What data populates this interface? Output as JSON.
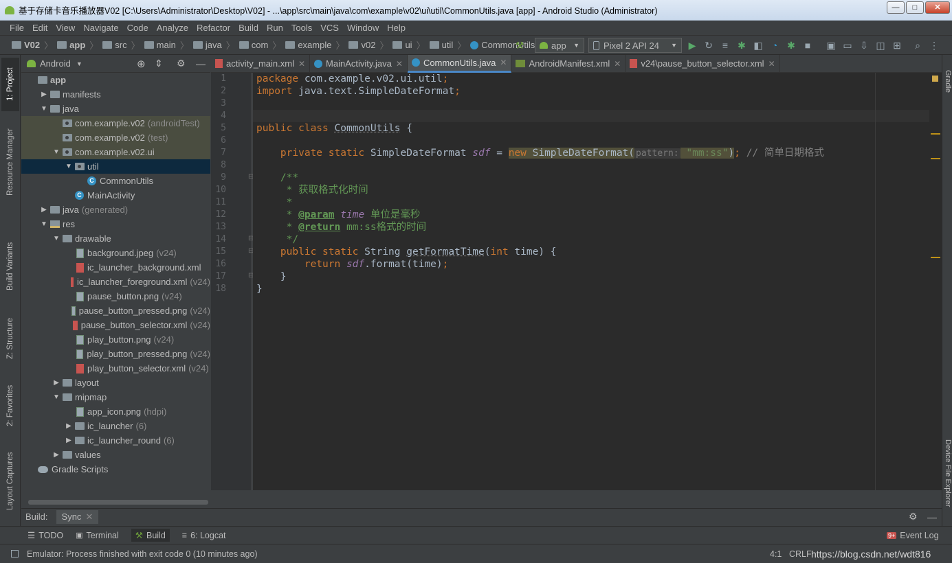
{
  "window": {
    "title": "基于存储卡音乐播放器V02 [C:\\Users\\Administrator\\Desktop\\V02] - ...\\app\\src\\main\\java\\com\\example\\v02\\ui\\util\\CommonUtils.java [app] - Android Studio (Administrator)",
    "controls": [
      "—",
      "□",
      "✕"
    ]
  },
  "menu": [
    "File",
    "Edit",
    "View",
    "Navigate",
    "Code",
    "Analyze",
    "Refactor",
    "Build",
    "Run",
    "Tools",
    "VCS",
    "Window",
    "Help"
  ],
  "breadcrumbs": [
    "V02",
    "app",
    "src",
    "main",
    "java",
    "com",
    "example",
    "v02",
    "ui",
    "util",
    "CommonUtils"
  ],
  "toolbar": {
    "run_config": "app",
    "device": "Pixel 2 API 24"
  },
  "left_tabs": [
    "1: Project",
    "Resource Manager",
    "Build Variants",
    "Z: Structure",
    "2: Favorites",
    "Layout Captures"
  ],
  "right_tabs": [
    "Gradle",
    "Device File Explorer"
  ],
  "project": {
    "view_mode": "Android",
    "tree": [
      {
        "label": "app",
        "extra": "",
        "indent": 0,
        "arrow": "",
        "icon": "folder",
        "bold": true
      },
      {
        "label": "manifests",
        "extra": "",
        "indent": 1,
        "arrow": "▶",
        "icon": "folder"
      },
      {
        "label": "java",
        "extra": "",
        "indent": 1,
        "arrow": "▼",
        "icon": "folder"
      },
      {
        "label": "com.example.v02",
        "extra": "(androidTest)",
        "indent": 2,
        "arrow": "",
        "icon": "pkg",
        "state": "hl"
      },
      {
        "label": "com.example.v02",
        "extra": "(test)",
        "indent": 2,
        "arrow": "",
        "icon": "pkg",
        "state": "hl"
      },
      {
        "label": "com.example.v02.ui",
        "extra": "",
        "indent": 2,
        "arrow": "▼",
        "icon": "pkg",
        "state": "hl"
      },
      {
        "label": "util",
        "extra": "",
        "indent": 3,
        "arrow": "▼",
        "icon": "pkg",
        "state": "sel"
      },
      {
        "label": "CommonUtils",
        "extra": "",
        "indent": 4,
        "arrow": "",
        "icon": "class"
      },
      {
        "label": "MainActivity",
        "extra": "",
        "indent": 3,
        "arrow": "",
        "icon": "class"
      },
      {
        "label": "java",
        "extra": "(generated)",
        "indent": 1,
        "arrow": "▶",
        "icon": "folder"
      },
      {
        "label": "res",
        "extra": "",
        "indent": 1,
        "arrow": "▼",
        "icon": "res"
      },
      {
        "label": "drawable",
        "extra": "",
        "indent": 2,
        "arrow": "▼",
        "icon": "folder"
      },
      {
        "label": "background.jpeg",
        "extra": "(v24)",
        "indent": 3,
        "arrow": "",
        "icon": "png"
      },
      {
        "label": "ic_launcher_background.xml",
        "extra": "",
        "indent": 3,
        "arrow": "",
        "icon": "xml"
      },
      {
        "label": "ic_launcher_foreground.xml",
        "extra": "(v24)",
        "indent": 3,
        "arrow": "",
        "icon": "xml"
      },
      {
        "label": "pause_button.png",
        "extra": "(v24)",
        "indent": 3,
        "arrow": "",
        "icon": "png"
      },
      {
        "label": "pause_button_pressed.png",
        "extra": "(v24)",
        "indent": 3,
        "arrow": "",
        "icon": "png"
      },
      {
        "label": "pause_button_selector.xml",
        "extra": "(v24)",
        "indent": 3,
        "arrow": "",
        "icon": "xml"
      },
      {
        "label": "play_button.png",
        "extra": "(v24)",
        "indent": 3,
        "arrow": "",
        "icon": "png"
      },
      {
        "label": "play_button_pressed.png",
        "extra": "(v24)",
        "indent": 3,
        "arrow": "",
        "icon": "png"
      },
      {
        "label": "play_button_selector.xml",
        "extra": "(v24)",
        "indent": 3,
        "arrow": "",
        "icon": "xml"
      },
      {
        "label": "layout",
        "extra": "",
        "indent": 2,
        "arrow": "▶",
        "icon": "folder"
      },
      {
        "label": "mipmap",
        "extra": "",
        "indent": 2,
        "arrow": "▼",
        "icon": "folder"
      },
      {
        "label": "app_icon.png",
        "extra": "(hdpi)",
        "indent": 3,
        "arrow": "",
        "icon": "png"
      },
      {
        "label": "ic_launcher",
        "extra": "(6)",
        "indent": 3,
        "arrow": "▶",
        "icon": "folder"
      },
      {
        "label": "ic_launcher_round",
        "extra": "(6)",
        "indent": 3,
        "arrow": "▶",
        "icon": "folder"
      },
      {
        "label": "values",
        "extra": "",
        "indent": 2,
        "arrow": "▶",
        "icon": "folder"
      },
      {
        "label": "Gradle Scripts",
        "extra": "",
        "indent": 0,
        "arrow": "",
        "icon": "gradle"
      }
    ]
  },
  "editor_tabs": [
    {
      "label": "activity_main.xml",
      "icon": "xml",
      "active": false
    },
    {
      "label": "MainActivity.java",
      "icon": "class",
      "active": false
    },
    {
      "label": "CommonUtils.java",
      "icon": "class",
      "active": true
    },
    {
      "label": "AndroidManifest.xml",
      "icon": "manifest",
      "active": false
    },
    {
      "label": "v24\\pause_button_selector.xml",
      "icon": "xml",
      "active": false
    }
  ],
  "code": {
    "line_numbers": [
      "1",
      "2",
      "3",
      "4",
      "5",
      "6",
      "7",
      "8",
      "9",
      "10",
      "11",
      "12",
      "13",
      "14",
      "15",
      "16",
      "17",
      "18"
    ],
    "lines": [
      [
        [
          "kw",
          "package "
        ],
        [
          "",
          "com.example.v02.ui.util"
        ],
        [
          "kw",
          ";"
        ]
      ],
      [
        [
          "kw",
          "import "
        ],
        [
          "",
          "java.text.SimpleDateFormat"
        ],
        [
          "kw",
          ";"
        ]
      ],
      [],
      [],
      [
        [
          "kw",
          "public class "
        ],
        [
          "unused",
          "CommonUtils"
        ],
        [
          "",
          " {"
        ]
      ],
      [],
      [
        [
          "",
          "    "
        ],
        [
          "kw",
          "private static "
        ],
        [
          "",
          "SimpleDateFormat "
        ],
        [
          "fld",
          "sdf"
        ],
        [
          "",
          " = "
        ],
        [
          "kw hlnew",
          "new "
        ],
        [
          "hlnew",
          "SimpleDateFormat("
        ],
        [
          "hint",
          "pattern:"
        ],
        [
          "str hlnew",
          " \"mm:ss\""
        ],
        [
          "hlnew",
          ")"
        ],
        [
          "kw",
          "; "
        ],
        [
          "cm",
          "// 简单日期格式"
        ]
      ],
      [],
      [
        [
          "",
          "    "
        ],
        [
          "doc",
          "/**"
        ]
      ],
      [
        [
          "",
          "    "
        ],
        [
          "doc",
          " * 获取格式化时间"
        ]
      ],
      [
        [
          "",
          "    "
        ],
        [
          "doc",
          " *"
        ]
      ],
      [
        [
          "",
          "    "
        ],
        [
          "doc",
          " * "
        ],
        [
          "tag",
          "@param"
        ],
        [
          "doc",
          " "
        ],
        [
          "fld",
          "time"
        ],
        [
          "doc",
          " 单位是毫秒"
        ]
      ],
      [
        [
          "",
          "    "
        ],
        [
          "doc",
          " * "
        ],
        [
          "tag",
          "@return"
        ],
        [
          "doc",
          " "
        ],
        [
          "doc",
          "mm:ss格式的时间"
        ]
      ],
      [
        [
          "",
          "    "
        ],
        [
          "doc",
          " */"
        ]
      ],
      [
        [
          "",
          "    "
        ],
        [
          "kw",
          "public static "
        ],
        [
          "",
          "String "
        ],
        [
          "unused",
          "getFormatTime"
        ],
        [
          "",
          "("
        ],
        [
          "kw",
          "int "
        ],
        [
          "",
          "time) {"
        ]
      ],
      [
        [
          "",
          "        "
        ],
        [
          "kw",
          "return "
        ],
        [
          "fld",
          "sdf"
        ],
        [
          "",
          ".format(time)"
        ],
        [
          "kw",
          ";"
        ]
      ],
      [
        [
          "",
          "    }"
        ]
      ],
      [
        [
          "",
          "}"
        ]
      ]
    ]
  },
  "build_panel": {
    "label": "Build:",
    "tab": "Sync"
  },
  "bottom_tools": [
    "TODO",
    "Terminal",
    "Build",
    "6: Logcat"
  ],
  "event_log": {
    "label": "Event Log",
    "badge": "9+"
  },
  "status": {
    "message": "Emulator: Process finished with exit code 0 (10 minutes ago)",
    "position": "4:1",
    "line_sep": "CRLF",
    "watermark": "https://blog.csdn.net/wdt816"
  }
}
